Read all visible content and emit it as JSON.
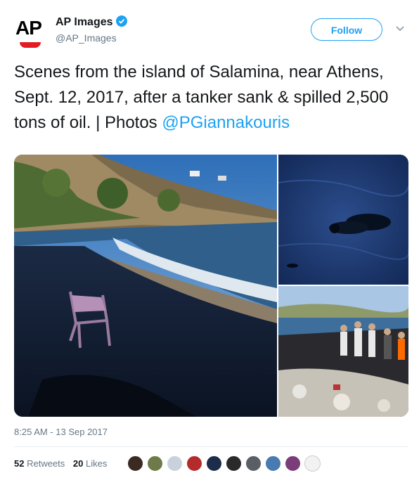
{
  "account": {
    "name": "AP Images",
    "handle": "@AP_Images",
    "avatar_icon": "ap-logo",
    "verified_icon": "verified-badge-icon"
  },
  "actions": {
    "follow_label": "Follow",
    "more_icon": "chevron-down-icon"
  },
  "tweet": {
    "text_part1": "Scenes from the island of Salamina, near Athens, Sept. 12, 2017, after a tanker sank & spilled 2,500 tons of oil. | Photos ",
    "mention": "@PGiannakouris",
    "timestamp": "8:25 AM - 13 Sep 2017"
  },
  "photos": [
    {
      "subject": "oil-covered beach with plastic chair"
    },
    {
      "subject": "oil-covered bird in black water"
    },
    {
      "subject": "workers cleaning oiled shoreline"
    }
  ],
  "stats": {
    "retweets_count": "52",
    "retweets_label": "Retweets",
    "likes_count": "20",
    "likes_label": "Likes"
  },
  "colors": {
    "accent": "#1da1f2",
    "text": "#14171a",
    "muted": "#657786"
  }
}
